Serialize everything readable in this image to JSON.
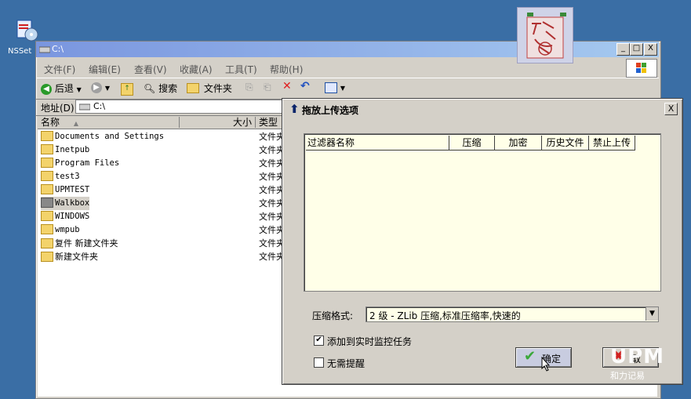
{
  "desktop": {
    "icon_label": "NSSet"
  },
  "explorer": {
    "title": "C:\\",
    "controls": {
      "minimize": "_",
      "maximize": "□",
      "close": "X"
    },
    "menu": [
      "文件(F)",
      "编辑(E)",
      "查看(V)",
      "收藏(A)",
      "工具(T)",
      "帮助(H)"
    ],
    "toolbar": {
      "back": "后退",
      "search": "搜索",
      "folders": "文件夹"
    },
    "address": {
      "label": "地址(D)",
      "value": "C:\\"
    },
    "columns": {
      "name": "名称",
      "size": "大小",
      "type": "类型"
    },
    "files": [
      {
        "name": "Documents and Settings",
        "type": "文件夹"
      },
      {
        "name": "Inetpub",
        "type": "文件夹"
      },
      {
        "name": "Program Files",
        "type": "文件夹"
      },
      {
        "name": "test3",
        "type": "文件夹"
      },
      {
        "name": "UPMTEST",
        "type": "文件夹"
      },
      {
        "name": "Walkbox",
        "type": "文件夹"
      },
      {
        "name": "WINDOWS",
        "type": "文件夹"
      },
      {
        "name": "wmpub",
        "type": "文件夹"
      },
      {
        "name": "复件 新建文件夹",
        "type": "文件夹"
      },
      {
        "name": "新建文件夹",
        "type": "文件夹"
      }
    ]
  },
  "dialog": {
    "title": "拖放上传选项",
    "close": "X",
    "table_headers": [
      "过滤器名称",
      "压缩",
      "加密",
      "历史文件",
      "禁止上传"
    ],
    "compression_label": "压缩格式:",
    "compression_value": "2 级 - ZLib 压缩,标准压缩率,快速的",
    "checkbox_monitor": {
      "label": "添加到实时监控任务",
      "checked": true
    },
    "checkbox_noremind": {
      "label": "无需提醒",
      "checked": false
    },
    "ok_label": "确定",
    "cancel_label": "取"
  },
  "watermark": {
    "logo": "UPM",
    "caption": "和力记易"
  },
  "colors": {
    "desktop": "#3a6ea5",
    "dialog_face": "#d4d0c8",
    "table_bg": "#ffffe8"
  }
}
